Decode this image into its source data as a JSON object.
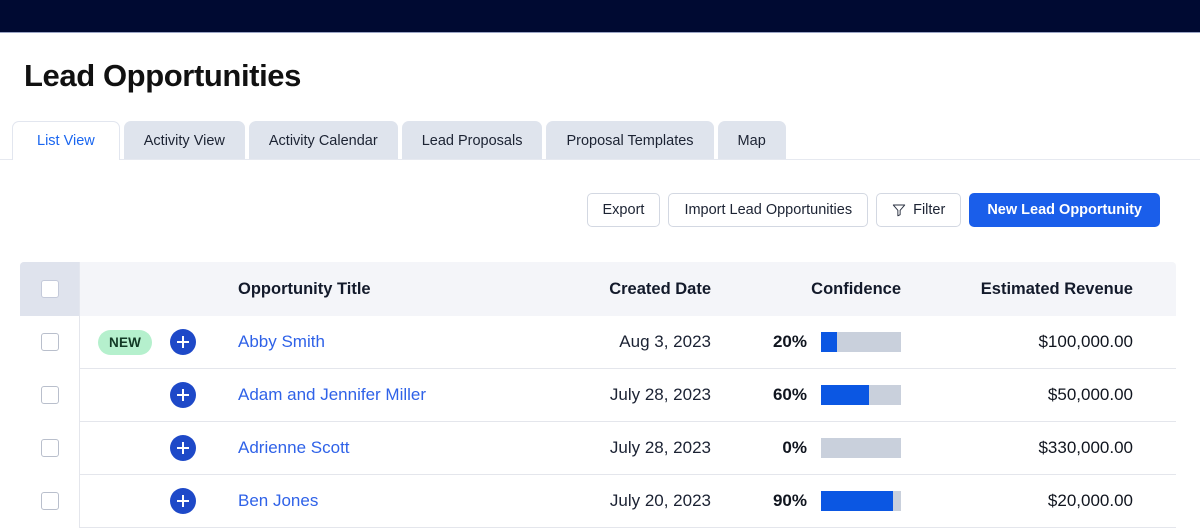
{
  "topbar": {
    "color": "#000a32"
  },
  "header": {
    "title": "Lead Opportunities"
  },
  "tabs": [
    {
      "label": "List View",
      "active": true
    },
    {
      "label": "Activity View",
      "active": false
    },
    {
      "label": "Activity Calendar",
      "active": false
    },
    {
      "label": "Lead Proposals",
      "active": false
    },
    {
      "label": "Proposal Templates",
      "active": false
    },
    {
      "label": "Map",
      "active": false
    }
  ],
  "toolbar": {
    "export_label": "Export",
    "import_label": "Import Lead Opportunities",
    "filter_label": "Filter",
    "filter_icon": "funnel-icon",
    "new_label": "New Lead Opportunity",
    "primary_color": "#1a5eea"
  },
  "table": {
    "columns": {
      "checkbox": "",
      "badge": "",
      "title": "Opportunity Title",
      "created_date": "Created Date",
      "confidence": "Confidence",
      "estimated_revenue": "Estimated Revenue"
    },
    "rows": [
      {
        "badge": "NEW",
        "title": "Abby Smith",
        "created_date": "Aug 3, 2023",
        "confidence_label": "20%",
        "confidence_value": 20,
        "estimated_revenue": "$100,000.00"
      },
      {
        "badge": "",
        "title": "Adam and Jennifer Miller",
        "created_date": "July 28, 2023",
        "confidence_label": "60%",
        "confidence_value": 60,
        "estimated_revenue": "$50,000.00"
      },
      {
        "badge": "",
        "title": "Adrienne Scott",
        "created_date": "July 28, 2023",
        "confidence_label": "0%",
        "confidence_value": 0,
        "estimated_revenue": "$330,000.00"
      },
      {
        "badge": "",
        "title": "Ben Jones",
        "created_date": "July 20, 2023",
        "confidence_label": "90%",
        "confidence_value": 90,
        "estimated_revenue": "$20,000.00"
      }
    ]
  },
  "colors": {
    "accent_blue": "#1a5eea",
    "link_blue": "#2f62e8",
    "bar_fill": "#0b57e3",
    "bar_track": "#c9d0dc",
    "badge_bg": "#b5f0cd",
    "badge_text": "#123925",
    "header_bg": "#f4f5f9",
    "tab_inactive_bg": "#dfe4ed"
  }
}
